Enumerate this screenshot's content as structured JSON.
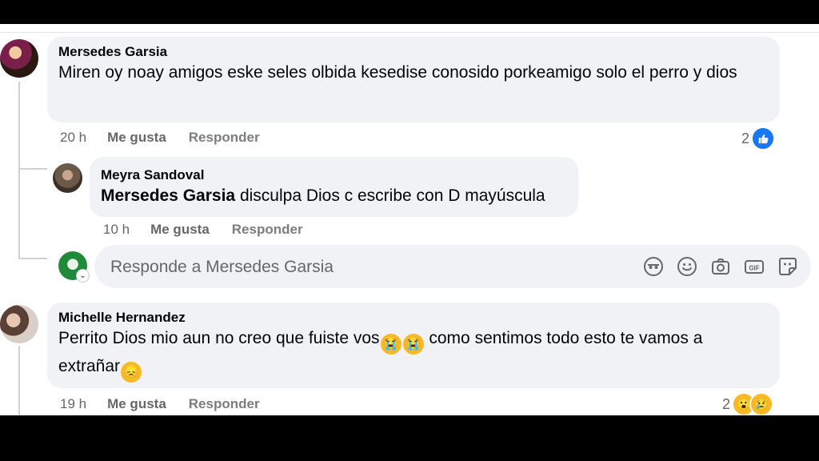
{
  "comments": [
    {
      "author": "Mersedes Garsia",
      "text": "Miren oy noay amigos eske seles olbida kesedise conosido porkeamigo solo el perro y dios",
      "time": "20 h",
      "like_label": "Me gusta",
      "reply_label": "Responder",
      "reaction_count": "2",
      "reactions": [
        "like"
      ]
    },
    {
      "author": "Michelle Hernandez",
      "text_a": "Perrito Dios mio aun no creo que fuiste vos",
      "text_b": " como sentimos todo esto te vamos a extrañar",
      "time": "19 h",
      "like_label": "Me gusta",
      "reply_label": "Responder",
      "reaction_count": "2",
      "reactions": [
        "wow",
        "sad"
      ]
    }
  ],
  "reply": {
    "author": "Meyra Sandoval",
    "mention": "Mersedes Garsia",
    "text": " disculpa Dios c escribe con D mayúscula",
    "time": "10 h",
    "like_label": "Me gusta",
    "reply_label": "Responder"
  },
  "reply_box": {
    "placeholder": "Responde a Mersedes Garsia"
  },
  "reply_tools": [
    "avatar-sticker-icon",
    "emoji-icon",
    "camera-icon",
    "gif-icon",
    "sticker-icon"
  ],
  "colors": {
    "like_blue": "#1877f2",
    "reaction_yellow": "#f7b928",
    "bubble_bg": "#f0f2f5",
    "meta_gray": "#65676b"
  }
}
